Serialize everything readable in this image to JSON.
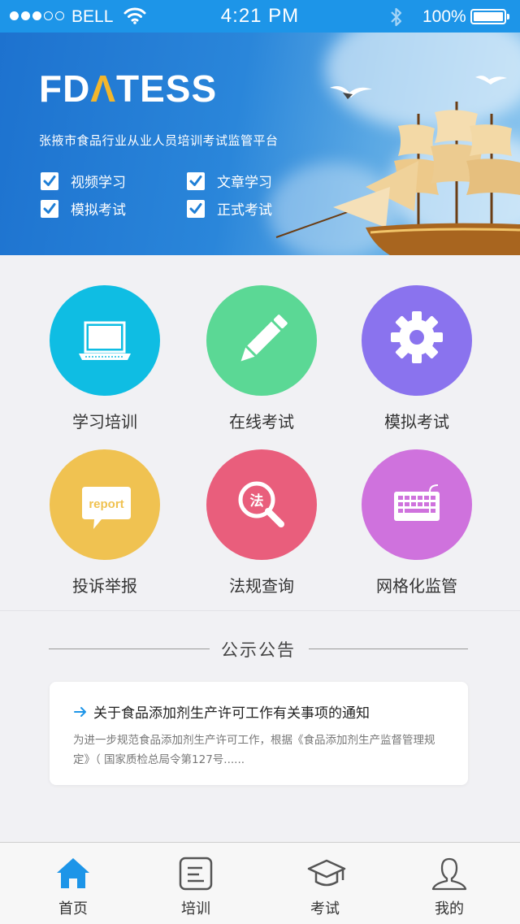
{
  "status_bar": {
    "carrier": "BELL",
    "time": "4:21 PM",
    "battery": "100%"
  },
  "banner": {
    "brand_prefix": "FD",
    "brand_highlight": "Λ",
    "brand_suffix": "TESS",
    "subtitle": "张掖市食品行业从业人员培训考试监管平台",
    "checklist": [
      "视频学习",
      "文章学习",
      "模拟考试",
      "正式考试"
    ]
  },
  "menu": {
    "items": [
      {
        "label": "学习培训",
        "icon": "laptop-icon",
        "color": "#0fbde3"
      },
      {
        "label": "在线考试",
        "icon": "pencil-icon",
        "color": "#5bd895"
      },
      {
        "label": "模拟考试",
        "icon": "gear-icon",
        "color": "#8a73ee"
      },
      {
        "label": "投诉举报",
        "icon": "report-bubble-icon",
        "color": "#f0c251",
        "icon_text": "report"
      },
      {
        "label": "法规查询",
        "icon": "law-search-icon",
        "color": "#e95e7c",
        "icon_text": "法"
      },
      {
        "label": "网格化监管",
        "icon": "keyboard-icon",
        "color": "#cf72dd"
      }
    ]
  },
  "notice": {
    "heading": "公示公告",
    "item_title": "关于食品添加剂生产许可工作有关事项的通知",
    "item_excerpt": "为进一步规范食品添加剂生产许可工作，根据《食品添加剂生产监督管理规定》（ 国家质检总局令第127号......"
  },
  "tab_bar": {
    "active_color": "#1d95e8",
    "tabs": [
      {
        "label": "首页",
        "icon": "home-icon",
        "active": true
      },
      {
        "label": "培训",
        "icon": "document-icon",
        "active": false
      },
      {
        "label": "考试",
        "icon": "graduation-cap-icon",
        "active": false
      },
      {
        "label": "我的",
        "icon": "user-icon",
        "active": false
      }
    ]
  }
}
